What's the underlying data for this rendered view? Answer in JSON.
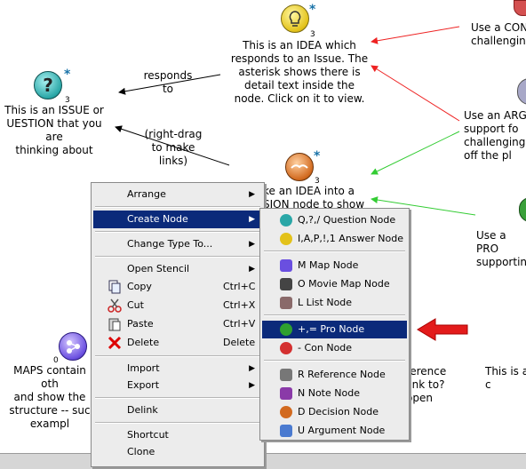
{
  "nodes": {
    "idea_text": "This is an IDEA which\nresponds to an Issue. The\nasterisk shows there is\ndetail text inside the\nnode. Click on it to view.",
    "idea_count": "3",
    "issue_text": "This is an ISSUE or\nUESTION that you are\nthinking about",
    "issue_count": "3",
    "decision_text": "ke an IDEA into a\nSION node to show",
    "decision_count": "3",
    "map_text": "MAPS contain oth\nand show the\nstructure -- suc\nexampl",
    "map_count": "0",
    "con_text": "Use a CON\nchallengin",
    "arg_text": "Use an ARG\nsupport fo\nchallenging\noff the pl",
    "pro_text": "Use a PRO\nsupportin",
    "ref_text": "ference\nlink to?\nopen",
    "right_text": "This is a\nc",
    "star": "*"
  },
  "links": {
    "responds_to": "responds\nto",
    "right_drag": "(right-drag\nto make\nlinks)"
  },
  "context_menu": {
    "arrange": "Arrange",
    "create_node": "Create Node",
    "change_type": "Change Type To...",
    "open_stencil": "Open Stencil",
    "copy": "Copy",
    "copy_sc": "Ctrl+C",
    "cut": "Cut",
    "cut_sc": "Ctrl+X",
    "paste": "Paste",
    "paste_sc": "Ctrl+V",
    "delete": "Delete",
    "delete_sc": "Delete",
    "import": "Import",
    "export": "Export",
    "delink": "Delink",
    "shortcut": "Shortcut",
    "clone": "Clone"
  },
  "submenu": {
    "question": "Q,?,/  Question Node",
    "answer": "I,A,P,!,1  Answer Node",
    "map": "M  Map Node",
    "movie": "O  Movie Map Node",
    "list": "L  List Node",
    "pro": "+,=  Pro Node",
    "con": "-  Con Node",
    "reference": "R  Reference Node",
    "note": "N  Note Node",
    "decision": "D  Decision Node",
    "argument": "U  Argument Node"
  },
  "colors": {
    "selection": "#0b2a7a",
    "arrow_red": "#e31b1b",
    "link_green": "#33dd33",
    "link_red": "#ee2222"
  }
}
